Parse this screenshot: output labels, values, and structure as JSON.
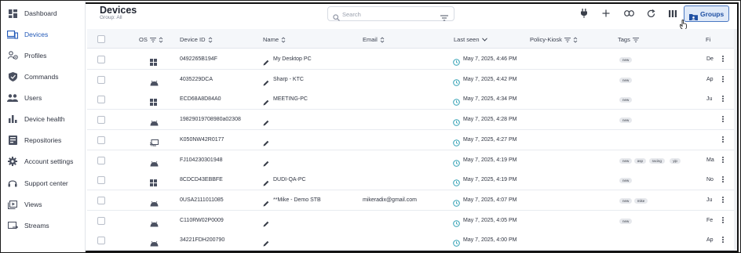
{
  "sidebar": {
    "items": [
      {
        "label": "Dashboard",
        "icon": "dashboard-icon"
      },
      {
        "label": "Devices",
        "icon": "devices-icon",
        "active": true
      },
      {
        "label": "Profiles",
        "icon": "profiles-icon"
      },
      {
        "label": "Commands",
        "icon": "shield-icon"
      },
      {
        "label": "Users",
        "icon": "users-icon"
      },
      {
        "label": "Device health",
        "icon": "bar-chart-icon"
      },
      {
        "label": "Repositories",
        "icon": "repository-icon"
      },
      {
        "label": "Account settings",
        "icon": "gear-icon"
      },
      {
        "label": "Support center",
        "icon": "headset-icon"
      },
      {
        "label": "Views",
        "icon": "views-icon"
      },
      {
        "label": "Streams",
        "icon": "streams-icon"
      }
    ]
  },
  "header": {
    "title": "Devices",
    "subtitle": "Group: All",
    "search_placeholder": "Search",
    "groups_label": "Groups"
  },
  "table": {
    "columns": {
      "os": "OS",
      "device_id": "Device ID",
      "name": "Name",
      "email": "Email",
      "last_seen": "Last seen",
      "policy": "Policy-Kiosk",
      "tags": "Tags",
      "fi": "Fi"
    },
    "rows": [
      {
        "os": "windows",
        "device_id": "0492265B194F",
        "name": "My Desktop PC",
        "email": "",
        "last_seen": "May 7, 2025, 4:46 PM",
        "tags": [
          "new"
        ],
        "fi": "De"
      },
      {
        "os": "android",
        "device_id": "4035229DCA",
        "name": "Sharp - KTC",
        "email": "",
        "last_seen": "May 7, 2025, 4:42 PM",
        "tags": [
          "new"
        ],
        "fi": "Ap"
      },
      {
        "os": "windows",
        "device_id": "ECD68A8D84A0",
        "name": "MEETING-PC",
        "email": "",
        "last_seen": "May 7, 2025, 4:34 PM",
        "tags": [
          "new"
        ],
        "fi": "Ju"
      },
      {
        "os": "android",
        "device_id": "19829019708980a02308",
        "name": "",
        "email": "",
        "last_seen": "May 7, 2025, 4:28 PM",
        "tags": [
          "new"
        ],
        "fi": ""
      },
      {
        "os": "cast",
        "device_id": "K050NW42R0177",
        "name": "",
        "email": "",
        "last_seen": "May 7, 2025, 4:27 PM",
        "tags": [],
        "fi": ""
      },
      {
        "os": "android",
        "device_id": "FJ104230301948",
        "name": "",
        "email": "",
        "last_seen": "May 7, 2025, 4:19 PM",
        "tags": [
          "new",
          "asp",
          "racing",
          "yip"
        ],
        "fi": "Ma"
      },
      {
        "os": "windows",
        "device_id": "8CDCD43EBBFE",
        "name": "DUDI-QA-PC",
        "email": "",
        "last_seen": "May 7, 2025, 4:19 PM",
        "tags": [
          "new"
        ],
        "fi": "No"
      },
      {
        "os": "android",
        "device_id": "0USA2111011085",
        "name": "**Mike - Demo STB",
        "email": "mikeradix@gmail.com",
        "last_seen": "May 7, 2025, 4:07 PM",
        "tags": [
          "new",
          "mike"
        ],
        "fi": "Ju"
      },
      {
        "os": "android",
        "device_id": "C110RW02P0009",
        "name": "",
        "email": "",
        "last_seen": "May 7, 2025, 4:05 PM",
        "tags": [
          "new"
        ],
        "fi": "Fe"
      },
      {
        "os": "android",
        "device_id": "34221FDH200790",
        "name": "",
        "email": "",
        "last_seen": "May 7, 2025, 4:00 PM",
        "tags": [],
        "fi": "Ap"
      }
    ]
  },
  "colors": {
    "accent": "#2158b7",
    "groups_bg": "#dfe9f8",
    "clock": "#2e9fb3"
  }
}
